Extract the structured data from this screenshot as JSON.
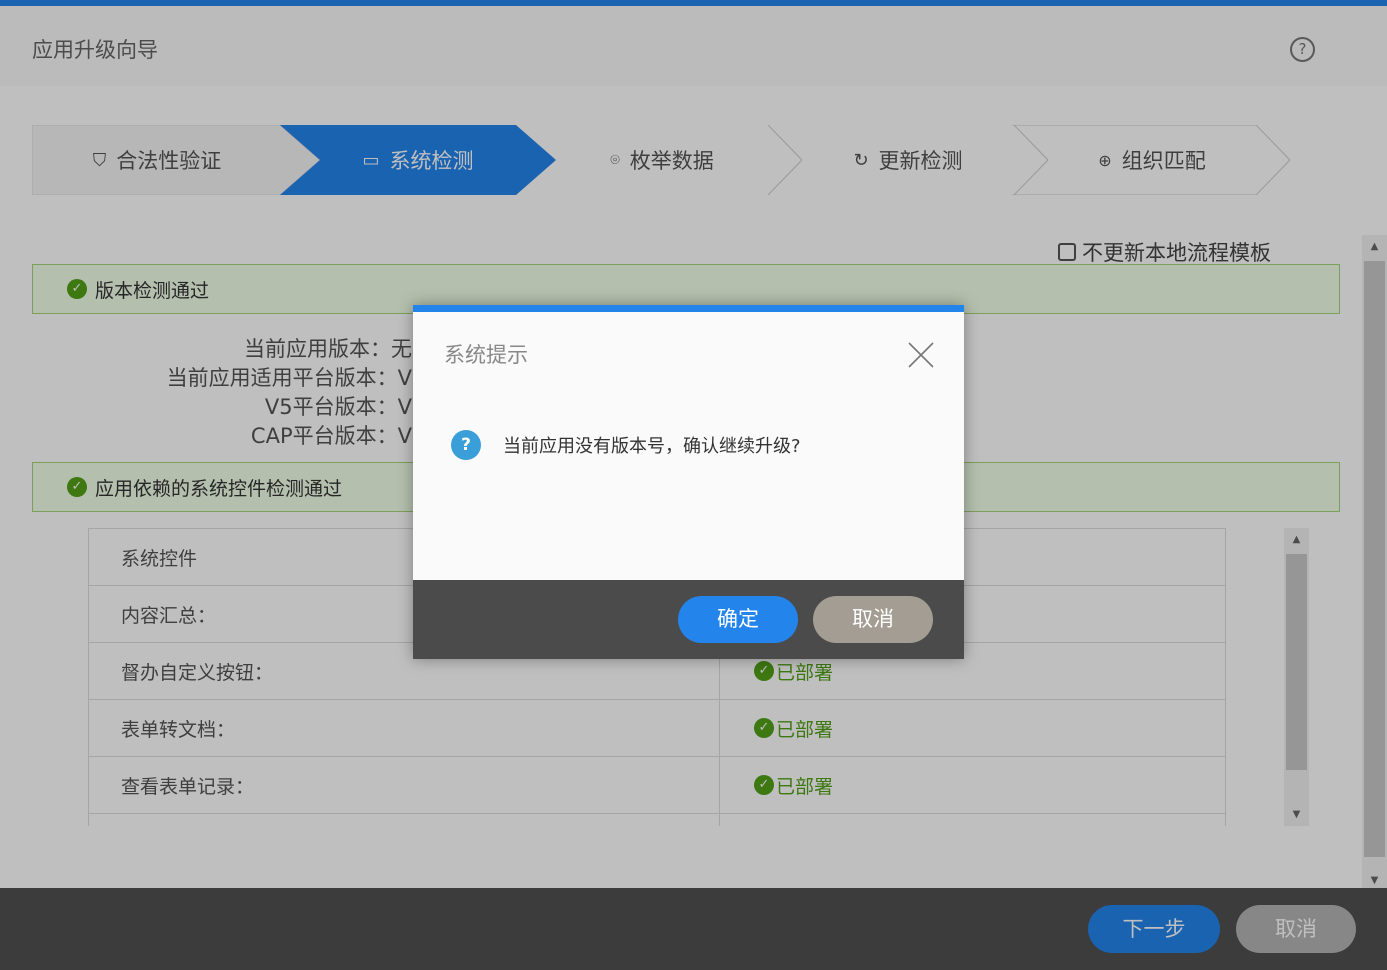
{
  "header": {
    "title": "应用升级向导",
    "help_icon": "question-circle-icon"
  },
  "steps": [
    {
      "label": "合法性验证",
      "icon": "shield-check-icon",
      "state": "done"
    },
    {
      "label": "系统检测",
      "icon": "monitor-touch-icon",
      "state": "active"
    },
    {
      "label": "枚举数据",
      "icon": "face-scan-icon",
      "state": "pending"
    },
    {
      "label": "更新检测",
      "icon": "refresh-icon",
      "state": "pending"
    },
    {
      "label": "组织匹配",
      "icon": "org-icon",
      "state": "pending"
    }
  ],
  "option": {
    "label": "不更新本地流程模板",
    "checked": false
  },
  "version_check": {
    "title": "版本检测通过",
    "fields": [
      {
        "label": "当前应用版本：",
        "value": "无"
      },
      {
        "label": "当前应用适用平台版本：",
        "value": "V"
      },
      {
        "label": "V5平台版本：",
        "value": "V"
      },
      {
        "label": "CAP平台版本：",
        "value": "V"
      }
    ]
  },
  "control_check": {
    "title": "应用依赖的系统控件检测通过"
  },
  "table": {
    "header": "系统控件",
    "rows": [
      {
        "name": "内容汇总：",
        "status": ""
      },
      {
        "name": "督办自定义按钮：",
        "status": "已部署"
      },
      {
        "name": "表单转文档：",
        "status": "已部署"
      },
      {
        "name": "查看表单记录：",
        "status": "已部署"
      }
    ]
  },
  "footer": {
    "next": "下一步",
    "cancel": "取消"
  },
  "dialog": {
    "title": "系统提示",
    "message": "当前应用没有版本号，确认继续升级?",
    "ok": "确定",
    "cancel": "取消"
  },
  "colors": {
    "accent": "#2384eb",
    "success": "#52a017"
  }
}
